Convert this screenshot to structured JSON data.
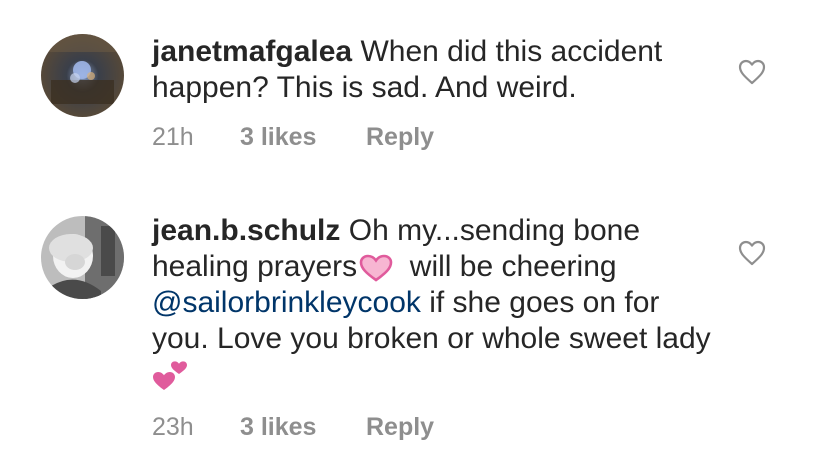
{
  "comments": [
    {
      "username": "janetmafgalea",
      "text": "When did this accident happen?  This is sad.  And weird.",
      "time": "21h",
      "likes": "3 likes",
      "reply": "Reply",
      "avatar_icon": "profile-photo"
    },
    {
      "username": "jean.b.schulz",
      "text_part1": "Oh my...sending bone healing prayers",
      "text_part2": "  will be cheering",
      "mention": "@sailorbrinkleycook",
      "text_part3": "  if she goes on for you.  Love you broken or whole sweet lady",
      "emoji_1": "pink-heart-emoji",
      "emoji_2": "two-hearts-emoji",
      "time": "23h",
      "likes": "3 likes",
      "reply": "Reply",
      "avatar_icon": "profile-photo"
    }
  ],
  "colors": {
    "text": "#262626",
    "meta": "#8e8e8e",
    "mention": "#003569",
    "heart_outline": "#8e8e8e",
    "emoji_pink": "#e05b9c"
  },
  "icons": {
    "like": "heart-outline-icon"
  }
}
